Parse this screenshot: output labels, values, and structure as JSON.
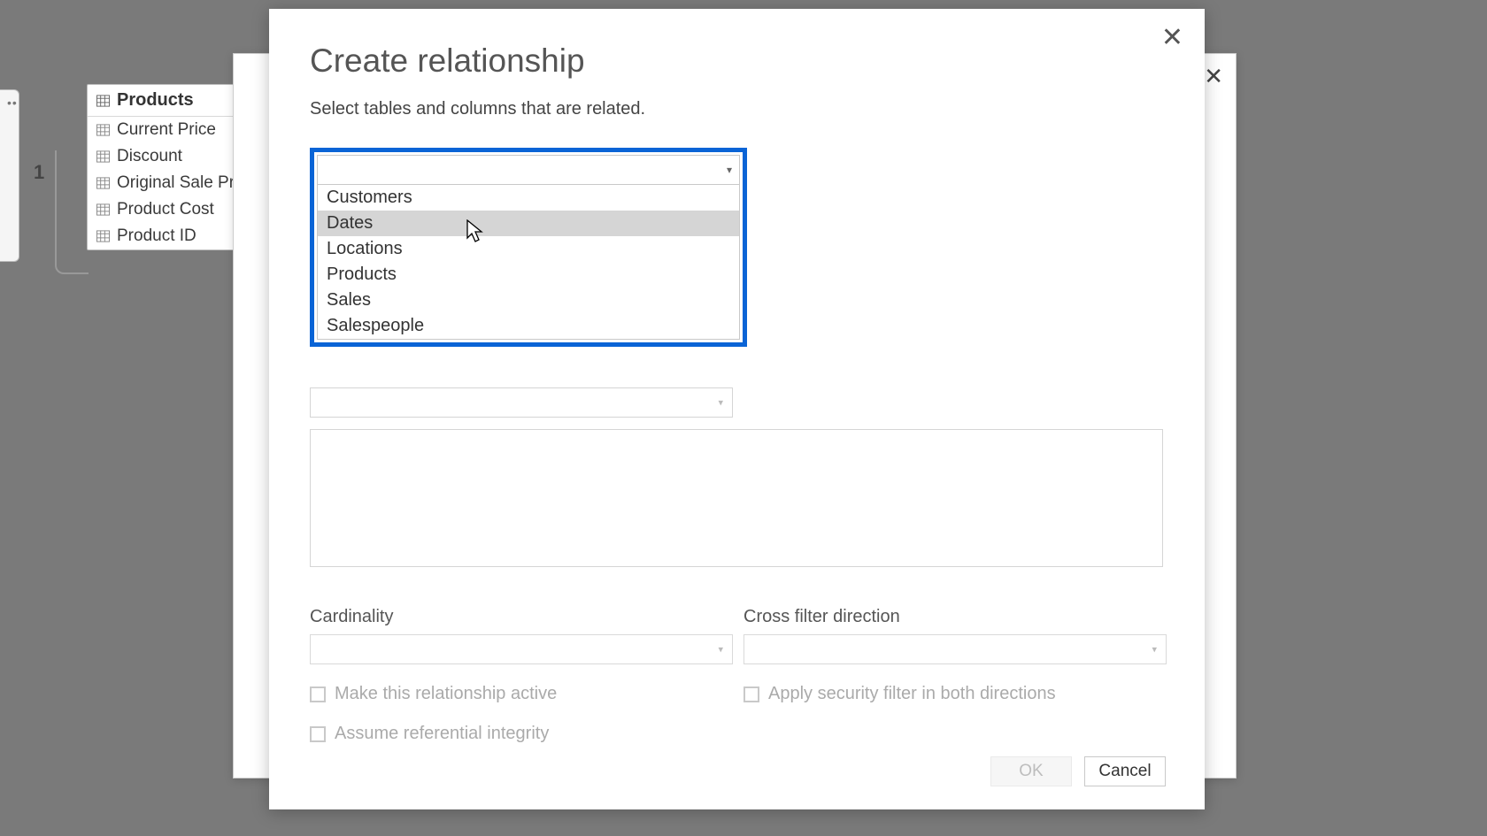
{
  "products_card": {
    "title": "Products",
    "fields": [
      "Current Price",
      "Discount",
      "Original Sale Pri",
      "Product Cost",
      "Product ID"
    ]
  },
  "link_label": "1",
  "dialog": {
    "title": "Create relationship",
    "subtitle": "Select tables and columns that are related.",
    "dropdown_options": [
      "Customers",
      "Dates",
      "Locations",
      "Products",
      "Sales",
      "Salespeople"
    ],
    "hover_index": 1,
    "cardinality_label": "Cardinality",
    "crossfilter_label": "Cross filter direction",
    "checkboxes": {
      "active": "Make this relationship active",
      "security": "Apply security filter in both directions",
      "referential": "Assume referential integrity"
    },
    "ok": "OK",
    "cancel": "Cancel"
  }
}
